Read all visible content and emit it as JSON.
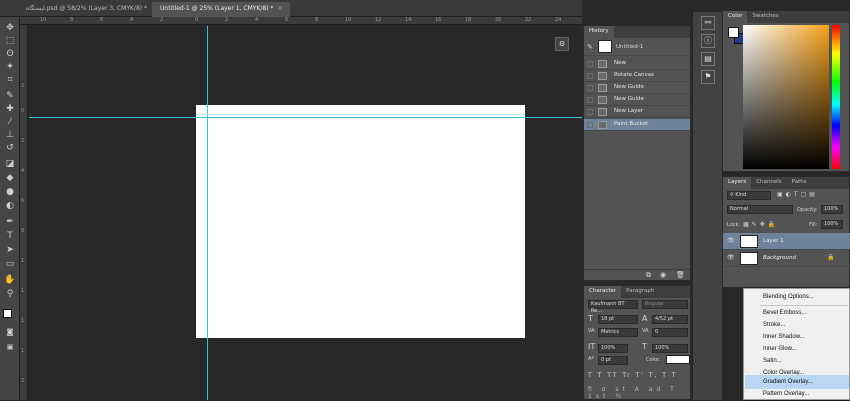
{
  "tabs": [
    {
      "label": "ایستگاه.psd @ 58/2% (Layer 3, CMYK/8) *",
      "active": false
    },
    {
      "label": "Untitled-1 @ 25% (Layer 1, CMYK/8) *",
      "active": true
    }
  ],
  "ruler": {
    "h_ticks": [
      "10",
      "8",
      "6",
      "4",
      "2",
      "0",
      "2",
      "4",
      "6",
      "8",
      "10",
      "12",
      "14",
      "16",
      "18",
      "20",
      "22",
      "24"
    ],
    "v_ticks": [
      "2",
      "0",
      "2",
      "4",
      "6",
      "8",
      "1",
      "1",
      "1",
      "1",
      "2"
    ]
  },
  "tools": [
    "move-tool",
    "marquee-tool",
    "lasso-tool",
    "magic-wand-tool",
    "crop-tool",
    "eyedropper-tool",
    "healing-tool",
    "brush-tool",
    "stamp-tool",
    "history-brush-tool",
    "eraser-tool",
    "paint-bucket-tool",
    "blur-tool",
    "dodge-tool",
    "pen-tool",
    "type-tool",
    "path-select-tool",
    "rectangle-tool",
    "hand-tool",
    "zoom-tool"
  ],
  "history": {
    "tab_label": "History",
    "snapshot": "Untitled-1",
    "items": [
      {
        "label": "New",
        "selected": false
      },
      {
        "label": "Rotate Canvas",
        "selected": false
      },
      {
        "label": "New Guide",
        "selected": false
      },
      {
        "label": "New Guide",
        "selected": false
      },
      {
        "label": "New Layer",
        "selected": false
      },
      {
        "label": "Paint Bucket",
        "selected": true
      }
    ]
  },
  "character": {
    "tabs": [
      "Character",
      "Paragraph"
    ],
    "font_family": "Kaufmann BT Re...",
    "font_style": "Regular",
    "font_size": "18 pt",
    "leading": "4/52 pt",
    "kerning": "Metrics",
    "tracking": "0",
    "vertical_scale": "100%",
    "horizontal_scale": "100%",
    "baseline_shift": "0 pt",
    "color_label": "Color:",
    "style_buttons": [
      "T",
      "T",
      "TT",
      "Tr",
      "T'",
      "T,",
      "T",
      "T"
    ]
  },
  "color": {
    "tabs": [
      "Color",
      "Swatches"
    ],
    "foreground": "#ffffff",
    "background": "#1f3b8f"
  },
  "layers": {
    "tabs": [
      "Layers",
      "Channels",
      "Paths"
    ],
    "filter_kind": "Kind",
    "blend_mode": "Normal",
    "opacity_label": "Opacity:",
    "opacity": "100%",
    "lock_label": "Lock:",
    "fill_label": "Fill:",
    "fill": "100%",
    "items": [
      {
        "name": "Layer 1",
        "selected": true,
        "italic": false
      },
      {
        "name": "Background",
        "selected": false,
        "italic": true
      }
    ]
  },
  "context_menu": {
    "items": [
      {
        "label": "Blending Options...",
        "highlighted": false
      },
      {
        "label": "Bevel  Emboss...",
        "highlighted": false
      },
      {
        "label": "Stroke...",
        "highlighted": false
      },
      {
        "label": "Inner Shadow...",
        "highlighted": false
      },
      {
        "label": "Inner Glow...",
        "highlighted": false
      },
      {
        "label": "Satin...",
        "highlighted": false
      },
      {
        "label": "Color Overlay...",
        "highlighted": false
      },
      {
        "label": "Gradient Overlay...",
        "highlighted": true
      },
      {
        "label": "Pattern Overlay...",
        "highlighted": false
      }
    ]
  },
  "colors": {
    "guide": "#35c5d7",
    "selection": "#6e839a",
    "menu_highlight": "#b7d7f3"
  }
}
